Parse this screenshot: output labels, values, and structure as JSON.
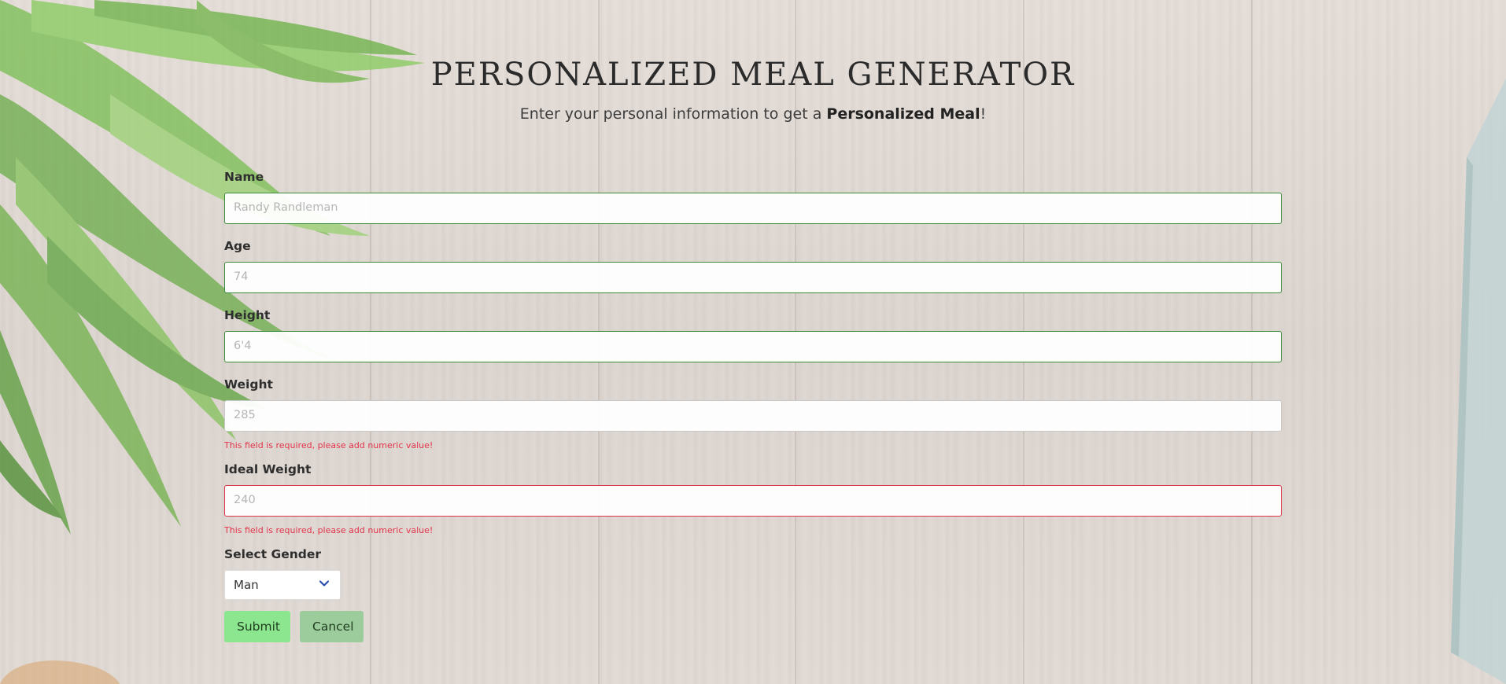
{
  "header": {
    "title": "PERSONALIZED MEAL GENERATOR",
    "subtitle_prefix": "Enter your personal information to get a ",
    "subtitle_bold": "Personalized Meal",
    "subtitle_suffix": "!"
  },
  "form": {
    "name": {
      "label": "Name",
      "placeholder": "Randy Randleman"
    },
    "age": {
      "label": "Age",
      "placeholder": "74"
    },
    "height": {
      "label": "Height",
      "placeholder": "6'4"
    },
    "weight": {
      "label": "Weight",
      "placeholder": "285",
      "error": "This field is required, please add numeric value!"
    },
    "ideal_weight": {
      "label": "Ideal Weight",
      "placeholder": "240",
      "error": "This field is required, please add numeric value!"
    },
    "gender": {
      "label": "Select Gender",
      "selected": "Man"
    }
  },
  "buttons": {
    "submit": "Submit",
    "cancel": "Cancel"
  },
  "colors": {
    "valid_border": "#3c8a3c",
    "error_border": "#dc3545",
    "error_text": "#e2344b",
    "submit_bg": "#8ce58f",
    "cancel_bg": "#9ccc9c"
  }
}
